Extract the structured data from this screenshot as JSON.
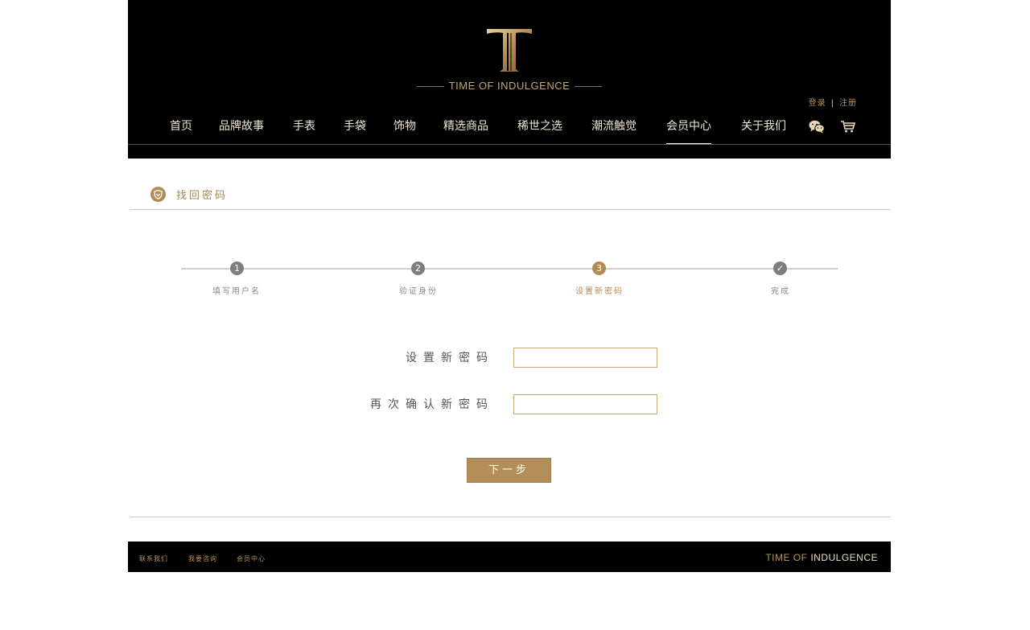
{
  "brand": {
    "logo_text": "TIME OF INDULGENCE",
    "footer_part1": "TIME OF ",
    "footer_part2": "INDULGENCE",
    "accent_color": "#b38b55"
  },
  "auth": {
    "login": "登录",
    "separator": "|",
    "register": "注册"
  },
  "nav": {
    "items": [
      {
        "label": "首页"
      },
      {
        "label": "品牌故事"
      },
      {
        "label": "手表"
      },
      {
        "label": "手袋"
      },
      {
        "label": "饰物"
      },
      {
        "label": "精选商品"
      },
      {
        "label": "稀世之选"
      },
      {
        "label": "潮流触觉"
      },
      {
        "label": "会员中心",
        "active": true
      },
      {
        "label": "关于我们"
      }
    ],
    "icons": [
      "wechat-icon",
      "cart-icon"
    ]
  },
  "section": {
    "title": "找回密码",
    "icon": "shield-icon"
  },
  "steps": [
    {
      "number": "1",
      "label": "填写用户名"
    },
    {
      "number": "2",
      "label": "验证身份"
    },
    {
      "number": "3",
      "label": "设置新密码",
      "active": true
    },
    {
      "number": "✓",
      "label": "完成"
    }
  ],
  "form": {
    "new_password_label": "设置新密码",
    "new_password_value": "",
    "confirm_password_label": "再次确认新密码",
    "confirm_password_value": "",
    "next_button": "下一步"
  },
  "footer": {
    "links": [
      "联系我们",
      "我要咨询",
      "会员中心"
    ]
  }
}
